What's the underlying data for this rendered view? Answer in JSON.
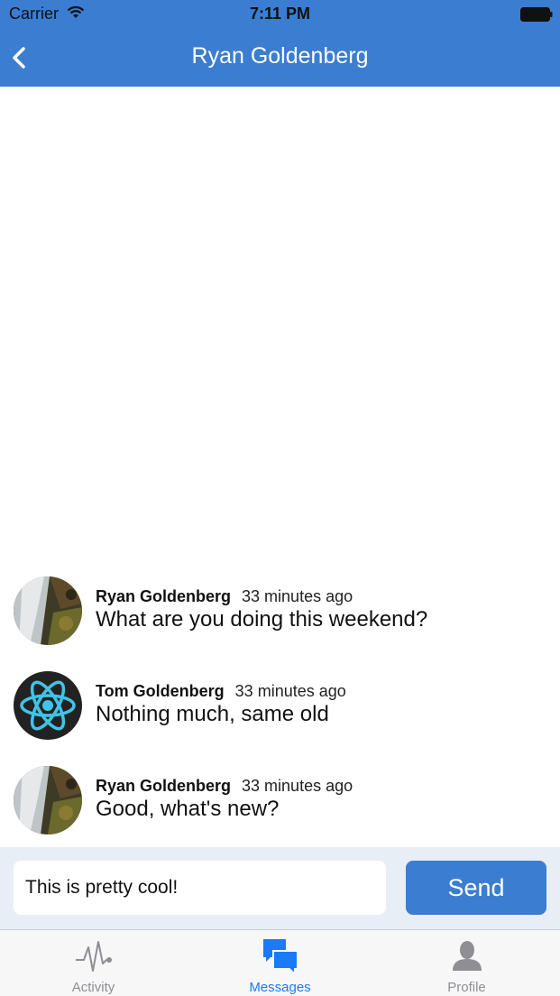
{
  "status_bar": {
    "carrier": "Carrier",
    "time": "7:11 PM"
  },
  "nav": {
    "title": "Ryan Goldenberg"
  },
  "messages": [
    {
      "author": "Ryan Goldenberg",
      "time": "33 minutes ago",
      "text": "What are you doing this weekend?",
      "avatar": "photo-waterfall"
    },
    {
      "author": "Tom Goldenberg",
      "time": "33 minutes ago",
      "text": "Nothing much, same old",
      "avatar": "react-logo"
    },
    {
      "author": "Ryan Goldenberg",
      "time": "33 minutes ago",
      "text": "Good, what's new?",
      "avatar": "photo-waterfall"
    }
  ],
  "composer": {
    "value": "This is pretty cool!",
    "send_label": "Send"
  },
  "tabs": [
    {
      "label": "Activity",
      "icon": "activity-pulse-icon",
      "active": false
    },
    {
      "label": "Messages",
      "icon": "chat-bubbles-icon",
      "active": true
    },
    {
      "label": "Profile",
      "icon": "person-icon",
      "active": false
    }
  ],
  "colors": {
    "brand": "#3b7dd1",
    "tab_active": "#1a7af7",
    "tab_inactive": "#8e8e93",
    "composer_bg": "#e8eef5"
  }
}
